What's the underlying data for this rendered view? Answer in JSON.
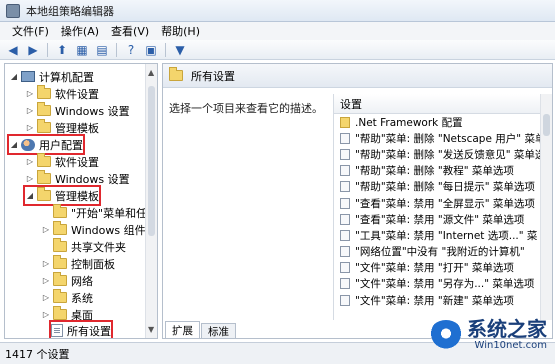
{
  "window": {
    "title": "本地组策略编辑器"
  },
  "menu": [
    "文件(F)",
    "操作(A)",
    "查看(V)",
    "帮助(H)"
  ],
  "toolbar": {
    "icons": [
      "back-icon",
      "forward-icon",
      "up-folder-icon",
      "show-hide-tree-icon",
      "export-icon",
      "help-icon",
      "properties-icon",
      "filter-icon"
    ]
  },
  "tree": {
    "computer_config": "计算机配置",
    "cc_software": "软件设置",
    "cc_windows": "Windows 设置",
    "cc_admin": "管理模板",
    "user_config": "用户配置",
    "uc_software": "软件设置",
    "uc_windows": "Windows 设置",
    "uc_admin": "管理模板",
    "start_menu": "\"开始\"菜单和任",
    "win_components": "Windows 组件",
    "shared_folders": "共享文件夹",
    "control_panel": "控制面板",
    "network": "网络",
    "system": "系统",
    "desktop": "桌面",
    "all_settings": "所有设置"
  },
  "right": {
    "header": "所有设置",
    "description": "选择一个项目来查看它的描述。",
    "column": "设置",
    "rows": [
      ".Net Framework 配置",
      "\"帮助\"菜单: 删除 \"Netscape 用户\" 菜单",
      "\"帮助\"菜单: 删除 \"发送反馈意见\" 菜单选",
      "\"帮助\"菜单: 删除 \"教程\" 菜单选项",
      "\"帮助\"菜单: 删除 \"每日提示\" 菜单选项",
      "\"查看\"菜单: 禁用 \"全屏显示\" 菜单选项",
      "\"查看\"菜单: 禁用 \"源文件\" 菜单选项",
      "\"工具\"菜单: 禁用 \"Internet 选项...\" 菜",
      "\"网络位置\"中没有 \"我附近的计算机\"",
      "\"文件\"菜单: 禁用 \"打开\" 菜单选项",
      "\"文件\"菜单: 禁用 \"另存为...\" 菜单选项",
      "\"文件\"菜单: 禁用 \"新建\" 菜单选项"
    ],
    "tabs": [
      "扩展",
      "标准"
    ]
  },
  "status": "1417 个设置",
  "watermark": {
    "main": "系统之家",
    "sub": "Win10net.com"
  }
}
